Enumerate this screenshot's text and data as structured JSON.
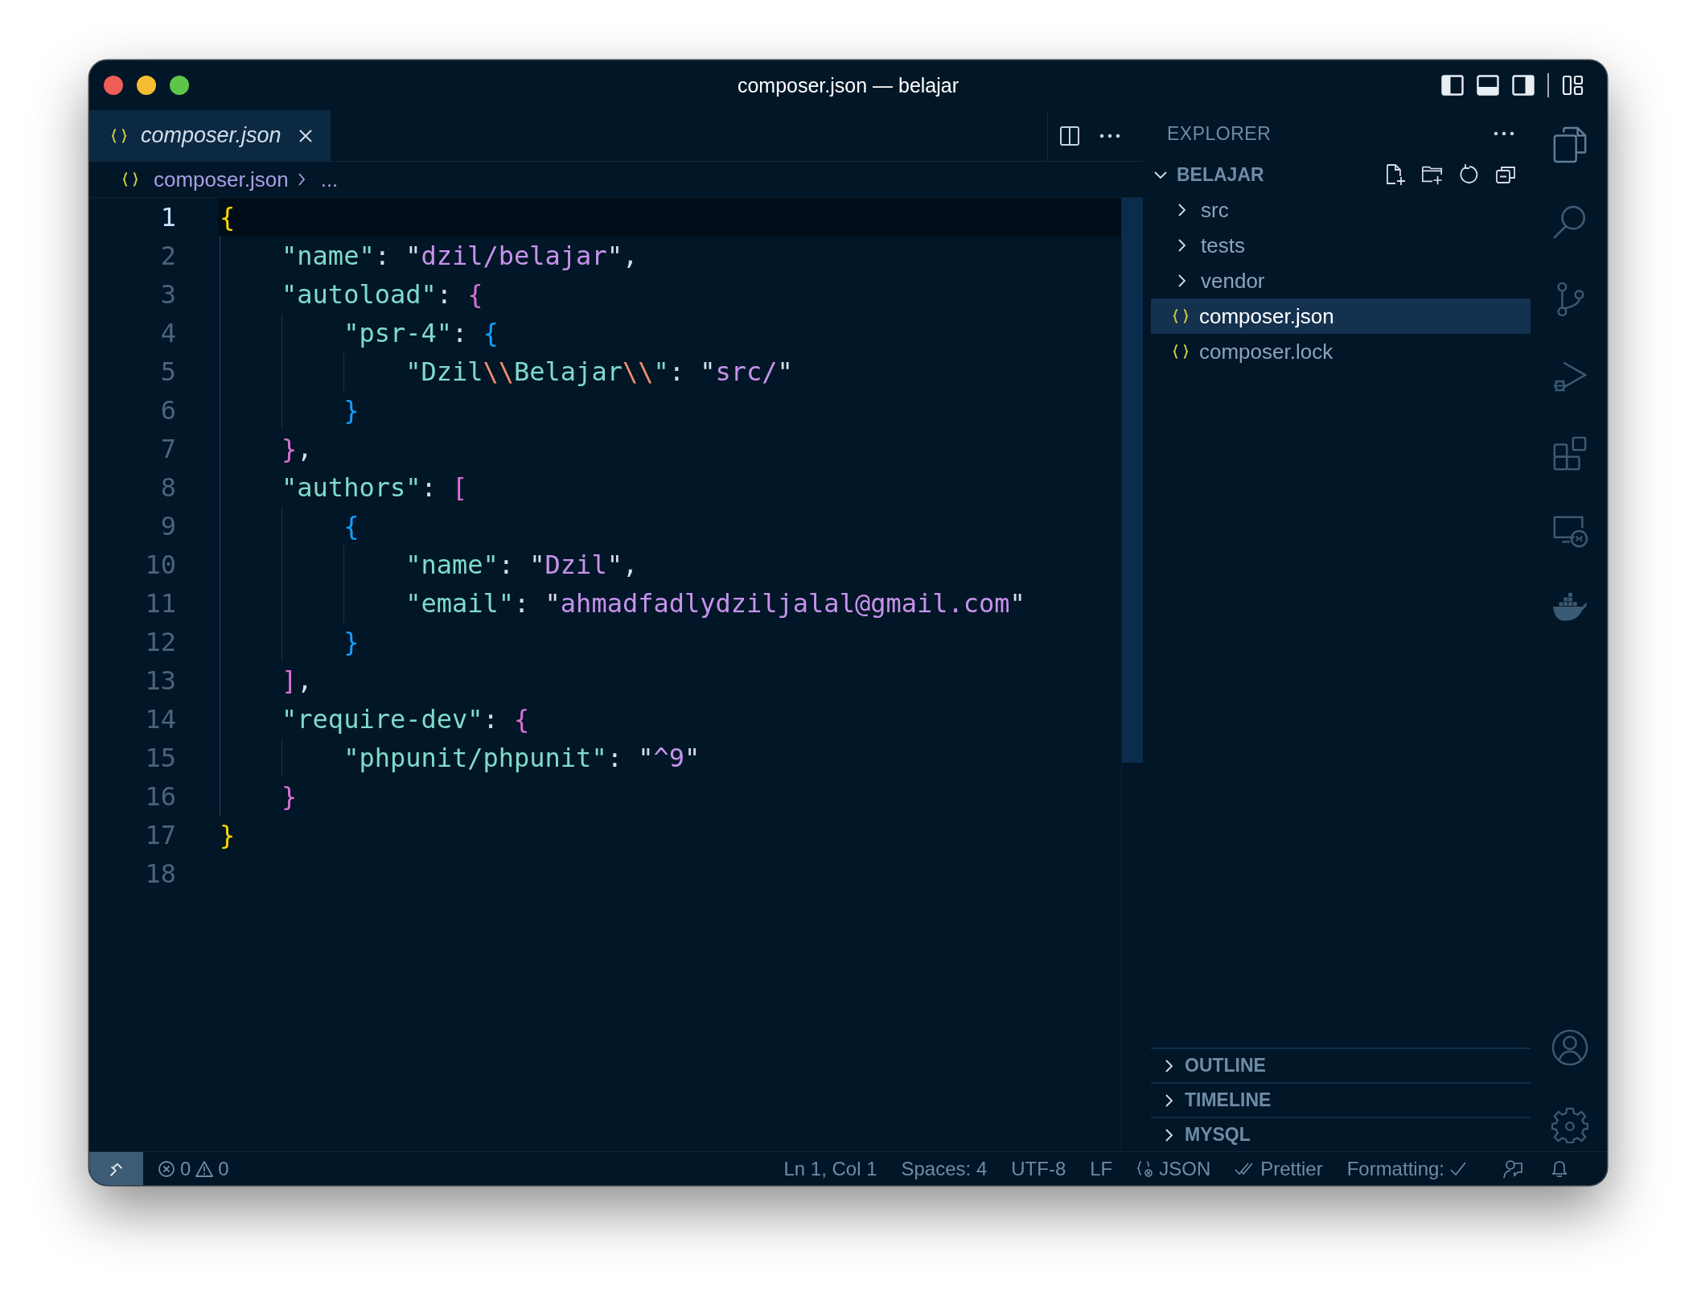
{
  "window": {
    "title": "composer.json — belajar"
  },
  "tabs": [
    {
      "label": "composer.json",
      "selected": true,
      "preview": true
    }
  ],
  "breadcrumb": [
    "composer.json",
    "..."
  ],
  "editor": {
    "lines": [
      {
        "number": "1",
        "current": true,
        "tokens": [
          {
            "kind": "open",
            "text": "{",
            "color": "#ffd700"
          }
        ]
      },
      {
        "number": "2",
        "current": false,
        "tokens": [
          {
            "kind": "key",
            "text": "\"name\""
          },
          {
            "kind": "punct",
            "text": ": \""
          },
          {
            "kind": "str",
            "text": "dzil/belajar"
          },
          {
            "kind": "punct",
            "text": "\","
          }
        ]
      },
      {
        "number": "3",
        "current": false,
        "tokens": [
          {
            "kind": "key",
            "text": "\"autoload\""
          },
          {
            "kind": "punct",
            "text": ": "
          },
          {
            "kind": "open",
            "text": "{",
            "color": "#da70d6"
          }
        ]
      },
      {
        "number": "4",
        "current": false,
        "tokens": [
          {
            "kind": "key",
            "text": "\"psr-4\""
          },
          {
            "kind": "punct",
            "text": ": "
          },
          {
            "kind": "open",
            "text": "{",
            "color": "#179fff"
          }
        ]
      },
      {
        "number": "5",
        "current": false,
        "tokens": [
          {
            "kind": "key",
            "text": "\"Dzil"
          },
          {
            "kind": "esc",
            "text": "\\\\"
          },
          {
            "kind": "key",
            "text": "Belajar"
          },
          {
            "kind": "esc",
            "text": "\\\\"
          },
          {
            "kind": "key",
            "text": "\""
          },
          {
            "kind": "punct",
            "text": ": \""
          },
          {
            "kind": "str",
            "text": "src/"
          },
          {
            "kind": "punct",
            "text": "\""
          }
        ]
      },
      {
        "number": "6",
        "current": false,
        "tokens": [
          {
            "kind": "close",
            "text": "}",
            "color": "#179fff"
          }
        ]
      },
      {
        "number": "7",
        "current": false,
        "tokens": [
          {
            "kind": "close",
            "text": "}",
            "color": "#da70d6"
          },
          {
            "kind": "punct",
            "text": ","
          }
        ]
      },
      {
        "number": "8",
        "current": false,
        "tokens": [
          {
            "kind": "key",
            "text": "\"authors\""
          },
          {
            "kind": "punct",
            "text": ": "
          },
          {
            "kind": "open",
            "text": "[",
            "color": "#da70d6"
          }
        ]
      },
      {
        "number": "9",
        "current": false,
        "tokens": [
          {
            "kind": "open",
            "text": "{",
            "color": "#179fff"
          }
        ]
      },
      {
        "number": "10",
        "current": false,
        "tokens": [
          {
            "kind": "key",
            "text": "\"name\""
          },
          {
            "kind": "punct",
            "text": ": \""
          },
          {
            "kind": "str",
            "text": "Dzil"
          },
          {
            "kind": "punct",
            "text": "\","
          }
        ]
      },
      {
        "number": "11",
        "current": false,
        "tokens": [
          {
            "kind": "key",
            "text": "\"email\""
          },
          {
            "kind": "punct",
            "text": ": \""
          },
          {
            "kind": "str",
            "text": "ahmadfadlydziljalal@gmail.com"
          },
          {
            "kind": "punct",
            "text": "\""
          }
        ]
      },
      {
        "number": "12",
        "current": false,
        "tokens": [
          {
            "kind": "close",
            "text": "}",
            "color": "#179fff"
          }
        ]
      },
      {
        "number": "13",
        "current": false,
        "tokens": [
          {
            "kind": "close",
            "text": "]",
            "color": "#da70d6"
          },
          {
            "kind": "punct",
            "text": ","
          }
        ]
      },
      {
        "number": "14",
        "current": false,
        "tokens": [
          {
            "kind": "key",
            "text": "\"require-dev\""
          },
          {
            "kind": "punct",
            "text": ": "
          },
          {
            "kind": "open",
            "text": "{",
            "color": "#da70d6"
          }
        ]
      },
      {
        "number": "15",
        "current": false,
        "tokens": [
          {
            "kind": "key",
            "text": "\"phpunit/phpunit\""
          },
          {
            "kind": "punct",
            "text": ": \""
          },
          {
            "kind": "str",
            "text": "^9"
          },
          {
            "kind": "punct",
            "text": "\""
          }
        ]
      },
      {
        "number": "16",
        "current": false,
        "tokens": [
          {
            "kind": "close",
            "text": "}",
            "color": "#da70d6"
          }
        ]
      },
      {
        "number": "17",
        "current": false,
        "tokens": [
          {
            "kind": "close",
            "text": "}",
            "color": "#ffd700"
          }
        ]
      },
      {
        "number": "18",
        "current": false
      }
    ]
  },
  "explorer": {
    "title": "EXPLORER",
    "folder": {
      "name": "BELAJAR",
      "expanded": true
    },
    "items": [
      {
        "name": "src",
        "kind": "folder",
        "expanded": false,
        "selected": false
      },
      {
        "name": "tests",
        "kind": "folder",
        "expanded": false,
        "selected": false
      },
      {
        "name": "vendor",
        "kind": "folder",
        "expanded": false,
        "selected": false
      },
      {
        "name": "composer.json",
        "kind": "file",
        "selected": true
      },
      {
        "name": "composer.lock",
        "kind": "file",
        "selected": false
      }
    ]
  },
  "panels": [
    {
      "title": "OUTLINE",
      "expanded": false
    },
    {
      "title": "TIMELINE",
      "expanded": false
    },
    {
      "title": "MYSQL",
      "expanded": false
    }
  ],
  "status_bar": {
    "errors": "0",
    "warnings": "0",
    "items": [
      {
        "kind": "text",
        "text": "Ln 1, Col 1"
      },
      {
        "kind": "text",
        "text": "Spaces: 4"
      },
      {
        "kind": "text",
        "text": "UTF-8"
      },
      {
        "kind": "text",
        "text": "LF"
      },
      {
        "kind": "language",
        "text": "JSON"
      },
      {
        "kind": "prettier",
        "text": "Prettier"
      },
      {
        "kind": "formatting",
        "text": "Formatting:"
      }
    ]
  }
}
